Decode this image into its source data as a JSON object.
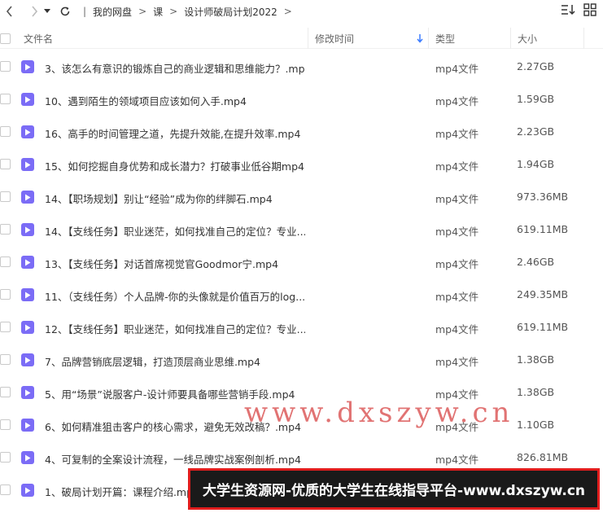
{
  "breadcrumb": {
    "items": [
      "我的网盘",
      "课",
      "设计师破局计划2022"
    ]
  },
  "columns": {
    "name": "文件名",
    "modified": "修改时间",
    "type": "类型",
    "size": "大小"
  },
  "files": [
    {
      "name": "3、该怎么有意识的锻炼自己的商业逻辑和思维能力？.mp4",
      "type": "mp4文件",
      "size": "2.27GB"
    },
    {
      "name": "10、遇到陌生的领域项目应该如何入手.mp4",
      "type": "mp4文件",
      "size": "1.59GB"
    },
    {
      "name": "16、高手的时间管理之道，先提升效能,在提升效率.mp4",
      "type": "mp4文件",
      "size": "2.23GB"
    },
    {
      "name": "15、如何挖掘自身优势和成长潜力？打破事业低谷期mp4...",
      "type": "mp4文件",
      "size": "1.94GB"
    },
    {
      "name": "14、【职场规划】别让“经验”成为你的绊脚石.mp4",
      "type": "mp4文件",
      "size": "973.36MB"
    },
    {
      "name": "14、【支线任务】职业迷茫，如何找准自己的定位？专业...",
      "type": "mp4文件",
      "size": "619.11MB"
    },
    {
      "name": "13、【支线任务】对话首席视觉官Goodmor宁.mp4",
      "type": "mp4文件",
      "size": "2.46GB"
    },
    {
      "name": "11、（支线任务）个人品牌-你的头像就是价值百万的log...",
      "type": "mp4文件",
      "size": "249.35MB"
    },
    {
      "name": "12、【支线任务】职业迷茫，如何找准自己的定位？专业...",
      "type": "mp4文件",
      "size": "619.11MB"
    },
    {
      "name": "7、品牌营销底层逻辑，打造顶层商业思维.mp4",
      "type": "mp4文件",
      "size": "1.38GB"
    },
    {
      "name": "5、用“场景”说服客户-设计师要具备哪些营销手段.mp4",
      "type": "mp4文件",
      "size": "1.38GB"
    },
    {
      "name": "6、如何精准狙击客户的核心需求，避免无效改稿？.mp4",
      "type": "mp4文件",
      "size": "1.10GB"
    },
    {
      "name": "4、可复制的全案设计流程，一线品牌实战案例剖析.mp4",
      "type": "mp4文件",
      "size": "826.81MB"
    },
    {
      "name": "1、破局计划开篇：课程介绍.mp4",
      "type": "mp4文件",
      "size": ""
    }
  ],
  "watermark": "www.dxszyw.cn",
  "banner": "大学生资源网-优质的大学生在线指导平台-www.dxszyw.cn",
  "colors": {
    "file_icon": "#7b6cf6",
    "sort_accent": "#3b7cff",
    "banner_border": "#e11d1d",
    "banner_bg": "#1a1a1a"
  }
}
